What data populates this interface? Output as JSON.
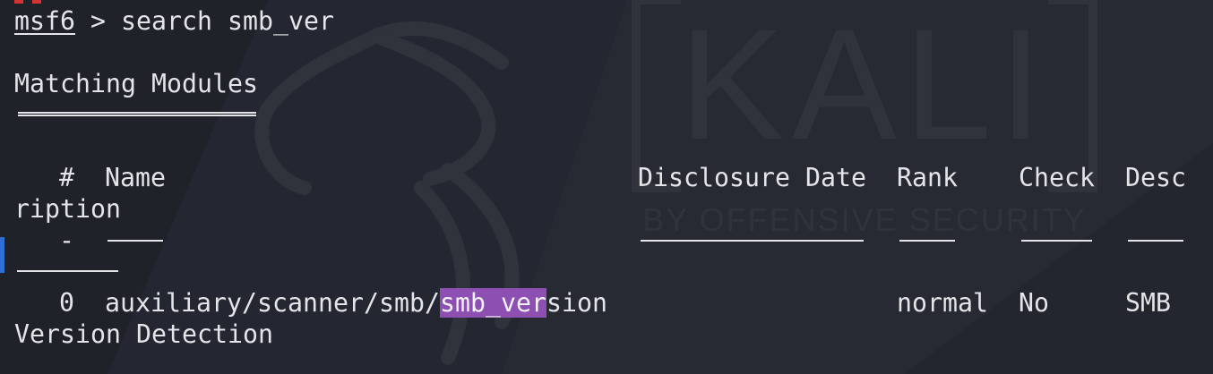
{
  "terminal": {
    "prompt_name": "msf6",
    "prompt_separator": " > ",
    "command": "search smb_ver",
    "heading": "Matching Modules",
    "table": {
      "header_num": "#",
      "header_name": "Name",
      "header_date": "Disclosure Date",
      "header_rank": "Rank",
      "header_check": "Check",
      "header_desc_part1": "Desc",
      "header_desc_part2": "ription",
      "header_num_rule": "-",
      "rows": [
        {
          "num": "0",
          "name_before": "auxiliary/scanner/smb/",
          "name_match": "smb_ver",
          "name_after": "sion",
          "date": "",
          "rank": "normal",
          "check": "No",
          "desc_part1": "SMB",
          "desc_part2": "Version Detection"
        }
      ]
    }
  },
  "wallpaper": {
    "logo_text": "KALI",
    "tagline": "BY OFFENSIVE SECURITY"
  },
  "colors": {
    "background": "#22252d",
    "text": "#e4e5e9",
    "highlight": "#8d4fb2",
    "accent_red": "#d53333",
    "accent_blue": "#2f6fd6"
  }
}
